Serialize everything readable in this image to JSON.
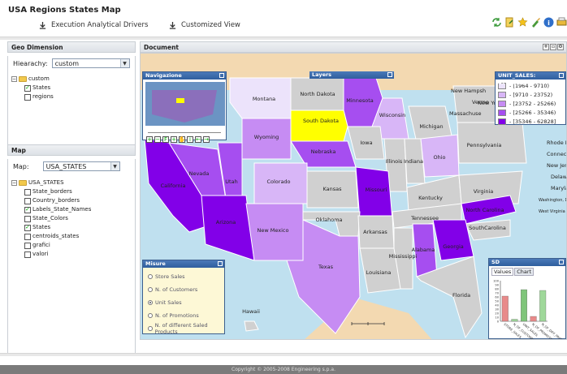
{
  "app": {
    "title": "USA Regions States Map"
  },
  "menu": {
    "execute_label": "Execution Analytical Drivers",
    "custom_label": "Customized View"
  },
  "toolbar_icons": [
    "refresh-icon",
    "export-icon",
    "star-icon",
    "brush-icon",
    "info-icon",
    "print-icon"
  ],
  "geo": {
    "header": "Geo Dimension",
    "hierarchy_label": "Hiearachy:",
    "hierarchy_value": "custom",
    "tree": {
      "root": "custom",
      "items": [
        {
          "label": "States",
          "checked": true
        },
        {
          "label": "regions",
          "checked": false
        }
      ]
    }
  },
  "map_panel": {
    "header": "Map",
    "map_label": "Map:",
    "map_value": "USA_STATES",
    "tree": {
      "root": "USA_STATES",
      "items": [
        {
          "label": "State_borders",
          "checked": false
        },
        {
          "label": "Country_borders",
          "checked": false
        },
        {
          "label": "Labels_State_Names",
          "checked": true
        },
        {
          "label": "State_Colors",
          "checked": false
        },
        {
          "label": "States",
          "checked": true
        },
        {
          "label": "centroids_states",
          "checked": false
        },
        {
          "label": "grafici",
          "checked": false
        },
        {
          "label": "valori",
          "checked": false
        }
      ]
    }
  },
  "document": {
    "header": "Document"
  },
  "navigazione": {
    "title": "Navigazione"
  },
  "layers": {
    "title": "Layers"
  },
  "legend": {
    "title": "UNIT_SALES: 47750.00",
    "rows": [
      {
        "label": "- [1964 - 9710)",
        "color": "#ece3fb"
      },
      {
        "label": "- [9710 - 23752)",
        "color": "#d8b6f7"
      },
      {
        "label": "- [23752 - 25266)",
        "color": "#c68cf3"
      },
      {
        "label": "- [25266 - 35346)",
        "color": "#a64ef0"
      },
      {
        "label": "- [35346 - 62828]",
        "color": "#8200e8"
      }
    ]
  },
  "misure": {
    "title": "Misure",
    "options": [
      {
        "label": "Store Sales",
        "selected": false
      },
      {
        "label": "N. of Customers",
        "selected": false
      },
      {
        "label": "Unit Sales",
        "selected": true
      },
      {
        "label": "N. of Promotions",
        "selected": false
      },
      {
        "label": "N. of different Saled Products",
        "selected": false
      }
    ]
  },
  "sd": {
    "title": "SD",
    "tabs": [
      "Values",
      "Chart"
    ],
    "chart_data": {
      "type": "bar",
      "categories": [
        "STORE_SALES",
        "N_OF_CUSTOMERS",
        "UNIT_SALES",
        "N_OF_PROMOTIONS",
        "N_OF_DIFF_PRODUCTS"
      ],
      "values": [
        62,
        5,
        78,
        12,
        76
      ],
      "colors": [
        "#e88a8a",
        "#9fd89a",
        "#7fc57a",
        "#e88a8a",
        "#9fd89a"
      ],
      "yticks": [
        "100",
        "90",
        "80",
        "70",
        "60",
        "50",
        "40",
        "30",
        "20",
        "10",
        "0"
      ],
      "ylim": [
        0,
        100
      ]
    }
  },
  "states": [
    {
      "name": "Montana",
      "color": "#ece3fb"
    },
    {
      "name": "North Dakota",
      "color": "#d0d0d0"
    },
    {
      "name": "Minnesota",
      "color": "#a64ef0"
    },
    {
      "name": "Wisconsin",
      "color": "#d8b6f7"
    },
    {
      "name": "Michigan",
      "color": "#d0d0d0"
    },
    {
      "name": "South Dakota",
      "color": "#ffff00"
    },
    {
      "name": "Wyoming",
      "color": "#c68cf3"
    },
    {
      "name": "Nebraska",
      "color": "#a64ef0"
    },
    {
      "name": "Iowa",
      "color": "#d0d0d0"
    },
    {
      "name": "Illinois",
      "color": "#d0d0d0"
    },
    {
      "name": "Indiana",
      "color": "#d0d0d0"
    },
    {
      "name": "Ohio",
      "color": "#d8b6f7"
    },
    {
      "name": "Pennsylvania",
      "color": "#d0d0d0"
    },
    {
      "name": "New York",
      "color": "#d0d0d0"
    },
    {
      "name": "Nevada",
      "color": "#a64ef0"
    },
    {
      "name": "Utah",
      "color": "#a64ef0"
    },
    {
      "name": "Colorado",
      "color": "#d8b6f7"
    },
    {
      "name": "Kansas",
      "color": "#d0d0d0"
    },
    {
      "name": "Missouri",
      "color": "#8200e8"
    },
    {
      "name": "Kentucky",
      "color": "#d0d0d0"
    },
    {
      "name": "Virginia",
      "color": "#d0d0d0"
    },
    {
      "name": "California",
      "color": "#8200e8"
    },
    {
      "name": "Arizona",
      "color": "#8200e8"
    },
    {
      "name": "New Mexico",
      "color": "#c68cf3"
    },
    {
      "name": "Oklahoma",
      "color": "#d0d0d0"
    },
    {
      "name": "Arkansas",
      "color": "#d0d0d0"
    },
    {
      "name": "Tennessee",
      "color": "#d0d0d0"
    },
    {
      "name": "North Carolina",
      "color": "#8200e8"
    },
    {
      "name": "SouthCarolina",
      "color": "#d0d0d0"
    },
    {
      "name": "Texas",
      "color": "#c68cf3"
    },
    {
      "name": "Mississippi",
      "color": "#d0d0d0"
    },
    {
      "name": "Alabama",
      "color": "#a64ef0"
    },
    {
      "name": "Georgia",
      "color": "#8200e8"
    },
    {
      "name": "Louisiana",
      "color": "#d0d0d0"
    },
    {
      "name": "Florida",
      "color": "#d0d0d0"
    },
    {
      "name": "Hawaii",
      "color": "#d0d0d0"
    }
  ],
  "east_labels": [
    "New Hampsh",
    "Vermo",
    "Massachuse",
    "Rhode Islan",
    "Connecticu",
    "New Jerse",
    "Delawar",
    "Marylan",
    "Washington, D.C",
    "West Virginia"
  ],
  "footer": {
    "text": "Copyright © 2005-2008 Engineering s.p.a."
  }
}
